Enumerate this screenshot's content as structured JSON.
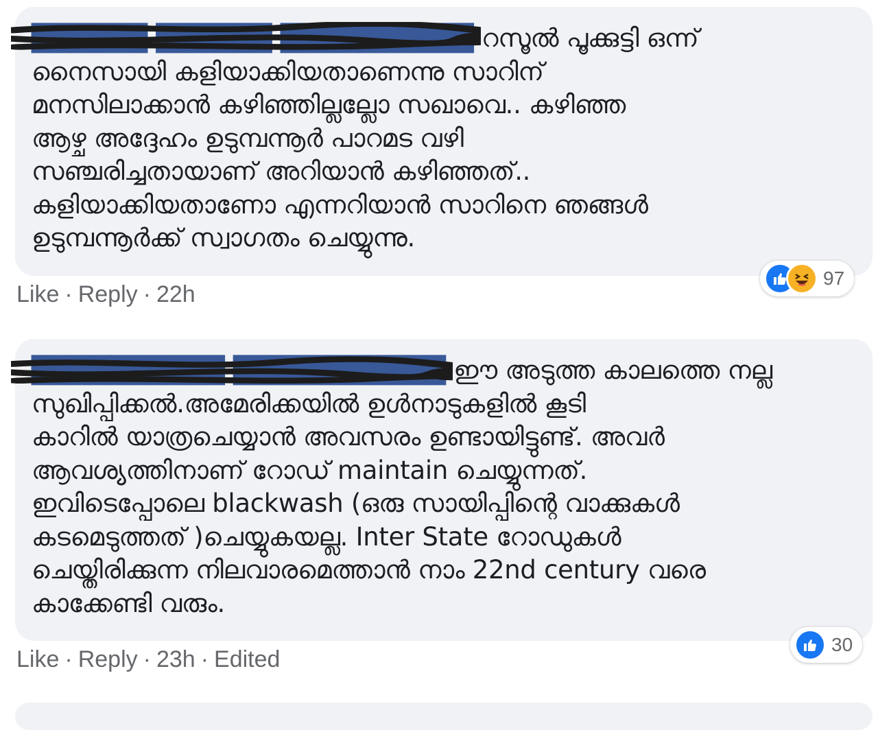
{
  "comments": [
    {
      "author": "██████ ██████ ██████████",
      "text": " റസൂൽ പൂക്കുട്ടി ഒന്ന്\nനൈസായി കളിയാക്കിയതാണെന്നു സാറിന്\nമനസിലാക്കാൻ കഴിഞ്ഞില്ലല്ലോ സഖാവെ.. കഴിഞ്ഞ\nആഴ്ച അദ്ദേഹം ഉടുമ്പന്നൂർ പാറമട വഴി\nസഞ്ചരിച്ചതായാണ് അറിയാൻ കഴിഞ്ഞത്..\nകളിയാക്കിയതാണോ എന്നറിയാൻ സാറിനെ ഞങ്ങൾ\nഉടുമ്പന്നൂർക്ക് സ്വാഗതം ചെയ്യുന്നു.",
      "reaction_count": "97",
      "reactions": [
        "like-icon",
        "haha-icon"
      ],
      "actions": {
        "like": "Like",
        "reply": "Reply",
        "time": "22h",
        "edited": ""
      }
    },
    {
      "author": "██████████ ███████████",
      "text": " ഈ അടുത്ത കാലത്തെ നല്ല\nസുഖിപ്പിക്കൽ.അമേരിക്കയിൽ ഉൾനാടുകളിൽ കൂടി\nകാറിൽ യാത്രചെയ്യാൻ അവസരം ഉണ്ടായിട്ടുണ്ട്. അവർ\nആവശ്യത്തിനാണ് റോഡ് maintain ചെയ്യുന്നത്.\nഇവിടെപ്പോലെ blackwash (ഒരു സായിപ്പിന്റെ വാക്കുകൾ\nകടമെടുത്തത് )ചെയ്യുകയല്ല. Inter State റോഡുകൾ\nചെയ്തിരിക്കുന്ന നിലവാരമെത്താൻ നാം 22nd century വരെ\nകാക്കേണ്ടി വരും.",
      "reaction_count": "30",
      "reactions": [
        "like-icon"
      ],
      "actions": {
        "like": "Like",
        "reply": "Reply",
        "time": "23h",
        "edited": "Edited"
      }
    }
  ],
  "ui": {
    "separator": "·"
  },
  "colors": {
    "bubble": "#f0f2f5",
    "meta": "#65676b",
    "like_blue": "#1877f2",
    "haha_yellow": "#f7b125",
    "scribble": "#1c1c1c"
  }
}
